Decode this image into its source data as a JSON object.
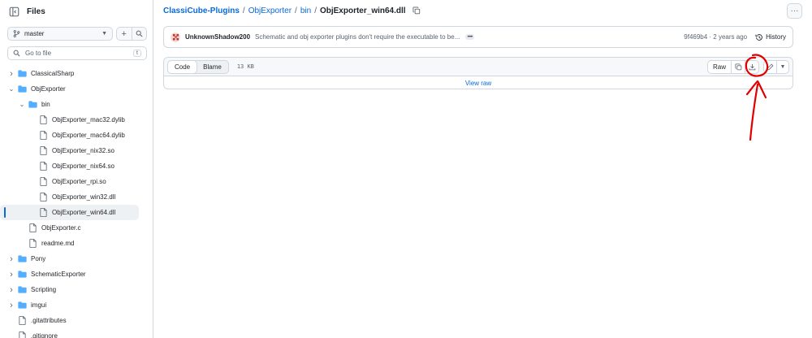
{
  "sidebar": {
    "title": "Files",
    "branch": "master",
    "search_placeholder": "Go to file",
    "search_shortcut": "t",
    "tree": [
      {
        "label": "ClassicalSharp",
        "type": "folder",
        "depth": 0,
        "expanded": false
      },
      {
        "label": "ObjExporter",
        "type": "folder",
        "depth": 0,
        "expanded": true
      },
      {
        "label": "bin",
        "type": "folder",
        "depth": 1,
        "expanded": true
      },
      {
        "label": "ObjExporter_mac32.dylib",
        "type": "file",
        "depth": 2
      },
      {
        "label": "ObjExporter_mac64.dylib",
        "type": "file",
        "depth": 2
      },
      {
        "label": "ObjExporter_nix32.so",
        "type": "file",
        "depth": 2
      },
      {
        "label": "ObjExporter_nix64.so",
        "type": "file",
        "depth": 2
      },
      {
        "label": "ObjExporter_rpi.so",
        "type": "file",
        "depth": 2
      },
      {
        "label": "ObjExporter_win32.dll",
        "type": "file",
        "depth": 2
      },
      {
        "label": "ObjExporter_win64.dll",
        "type": "file",
        "depth": 2,
        "selected": true
      },
      {
        "label": "ObjExporter.c",
        "type": "file",
        "depth": 1
      },
      {
        "label": "readme.md",
        "type": "file",
        "depth": 1
      },
      {
        "label": "Pony",
        "type": "folder",
        "depth": 0,
        "expanded": false
      },
      {
        "label": "SchematicExporter",
        "type": "folder",
        "depth": 0,
        "expanded": false
      },
      {
        "label": "Scripting",
        "type": "folder",
        "depth": 0,
        "expanded": false
      },
      {
        "label": "imgui",
        "type": "folder",
        "depth": 0,
        "expanded": false
      },
      {
        "label": ".gitattributes",
        "type": "file",
        "depth": 0
      },
      {
        "label": ".gitignore",
        "type": "file",
        "depth": 0
      }
    ]
  },
  "breadcrumb": {
    "repo": "ClassiCube-Plugins",
    "sep": "/",
    "parts": [
      "ObjExporter",
      "bin"
    ],
    "current": "ObjExporter_win64.dll"
  },
  "commit": {
    "author": "UnknownShadow200",
    "message": "Schematic and obj exporter plugins don't require the executable to be...",
    "hash_time": "9f469b4 · 2 years ago",
    "history_label": "History"
  },
  "file": {
    "tab_code": "Code",
    "tab_blame": "Blame",
    "size": "13 KB",
    "raw_label": "Raw",
    "view_raw": "View raw"
  },
  "colors": {
    "accent": "#0969da",
    "border": "#d0d7de",
    "folder": "#54aeff",
    "annotation": "#e00000"
  }
}
